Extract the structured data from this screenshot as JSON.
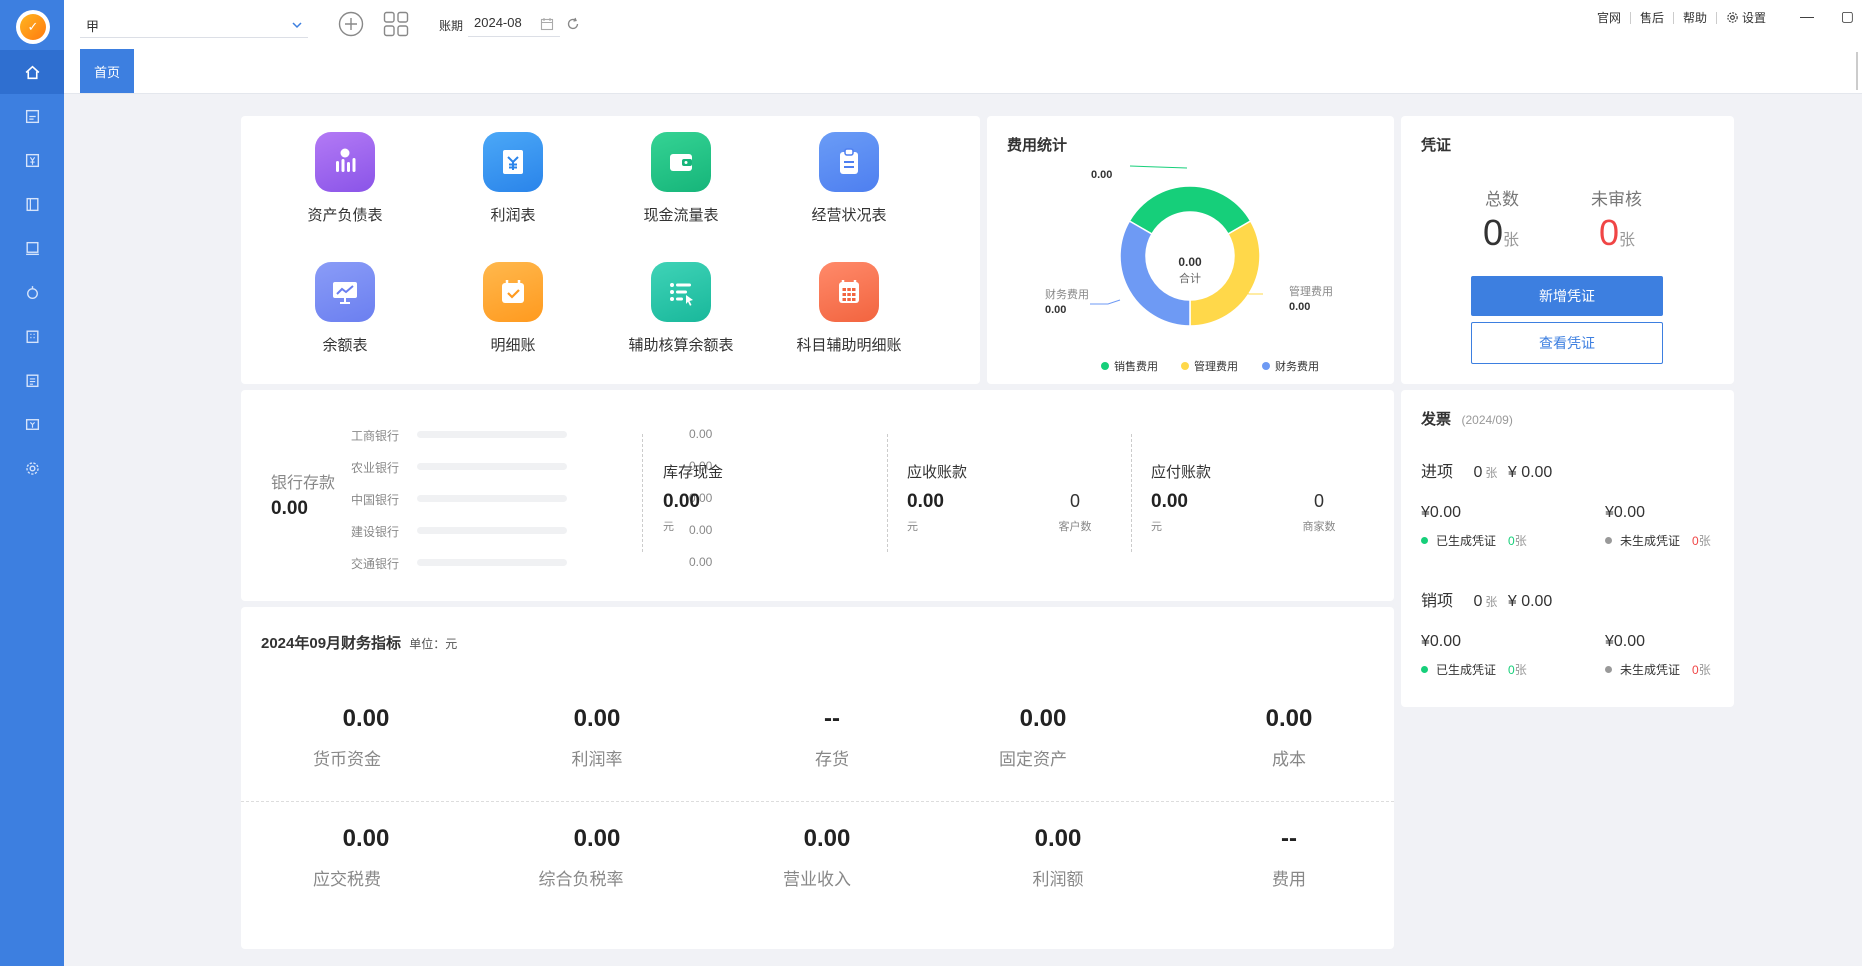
{
  "topbar": {
    "company": "甲",
    "period_label": "账期",
    "period_value": "2024-08",
    "links": [
      "官网",
      "售后",
      "帮助",
      "设置"
    ],
    "minimize": "—",
    "maximize": "▢"
  },
  "tabs": [
    {
      "label": "首页"
    }
  ],
  "reports": [
    {
      "label": "资产负债表",
      "color_a": "#b37af5",
      "color_b": "#8a54e8"
    },
    {
      "label": "利润表",
      "color_a": "#4ba8f7",
      "color_b": "#2a84ea"
    },
    {
      "label": "现金流量表",
      "color_a": "#35d394",
      "color_b": "#16b57a"
    },
    {
      "label": "经营状况表",
      "color_a": "#6a9cf6",
      "color_b": "#4e7ff0"
    },
    {
      "label": "余额表",
      "color_a": "#8a9cf7",
      "color_b": "#6b7ff0"
    },
    {
      "label": "明细账",
      "color_a": "#ffb84d",
      "color_b": "#ff9a1f"
    },
    {
      "label": "辅助核算余额表",
      "color_a": "#3fd3b7",
      "color_b": "#19b89b"
    },
    {
      "label": "科目辅助明细账",
      "color_a": "#ff8a6a",
      "color_b": "#f2643f"
    }
  ],
  "expense": {
    "title": "费用统计",
    "center_value": "0.00",
    "center_label": "合计",
    "labels": [
      {
        "name": "",
        "value": "0.00"
      },
      {
        "name": "财务费用",
        "value": "0.00"
      },
      {
        "name": "管理费用",
        "value": "0.00"
      }
    ],
    "legend": [
      {
        "name": "销售费用",
        "color": "#16cf7a"
      },
      {
        "name": "管理费用",
        "color": "#ffd84a"
      },
      {
        "name": "财务费用",
        "color": "#6e9af4"
      }
    ]
  },
  "chart_data": {
    "type": "pie",
    "title": "费用统计",
    "categories": [
      "销售费用",
      "管理费用",
      "财务费用"
    ],
    "values": [
      0.0,
      0.0,
      0.0
    ],
    "total": 0.0,
    "legend": "bottom"
  },
  "voucher": {
    "title": "凭证",
    "total_label": "总数",
    "total_value": "0",
    "unreviewed_label": "未审核",
    "unreviewed_value": "0",
    "unit": "张",
    "new_button": "新增凭证",
    "view_button": "查看凭证"
  },
  "bank": {
    "label": "银行存款",
    "value": "0.00",
    "rows": [
      {
        "name": "工商银行",
        "amount": "0.00",
        "fill": 0
      },
      {
        "name": "农业银行",
        "amount": "0.00",
        "fill": 0
      },
      {
        "name": "中国银行",
        "amount": "0.00",
        "fill": 0
      },
      {
        "name": "建设银行",
        "amount": "0.00",
        "fill": 0
      },
      {
        "name": "交通银行",
        "amount": "0.00",
        "fill": 0
      }
    ],
    "cash": {
      "title": "库存现金",
      "value": "0.00",
      "unit": "元"
    },
    "receivable": {
      "title": "应收账款",
      "value": "0.00",
      "unit": "元",
      "count": "0",
      "count_label": "客户数"
    },
    "payable": {
      "title": "应付账款",
      "value": "0.00",
      "unit": "元",
      "count": "0",
      "count_label": "商家数"
    }
  },
  "indicators": {
    "title": "2024年09月财务指标",
    "unit_label": "单位：元",
    "row1": [
      {
        "value": "0.00",
        "label": "货币资金"
      },
      {
        "value": "0.00",
        "label": "利润率"
      },
      {
        "value": "--",
        "label": "存货"
      },
      {
        "value": "0.00",
        "label": "固定资产"
      },
      {
        "value": "0.00",
        "label": "成本"
      }
    ],
    "row2": [
      {
        "value": "0.00",
        "label": "应交税费"
      },
      {
        "value": "0.00",
        "label": "综合负税率"
      },
      {
        "value": "0.00",
        "label": "营业收入"
      },
      {
        "value": "0.00",
        "label": "利润额"
      },
      {
        "value": "--",
        "label": "费用"
      }
    ]
  },
  "invoice": {
    "title": "发票",
    "period": "(2024/09)",
    "input": {
      "label": "进项",
      "count": "0",
      "unit": "张",
      "amount": "¥ 0.00",
      "generated_amount": "¥0.00",
      "generated_label": "已生成凭证",
      "generated_count": "0",
      "not_generated_amount": "¥0.00",
      "not_generated_label": "未生成凭证",
      "not_generated_count": "0"
    },
    "output": {
      "label": "销项",
      "count": "0",
      "unit": "张",
      "amount": "¥ 0.00",
      "generated_amount": "¥0.00",
      "generated_label": "已生成凭证",
      "generated_count": "0",
      "not_generated_amount": "¥0.00",
      "not_generated_label": "未生成凭证",
      "not_generated_count": "0"
    },
    "colors": {
      "generated": "#16cf7a",
      "not_generated": "#999999",
      "red": "#f04545"
    }
  }
}
